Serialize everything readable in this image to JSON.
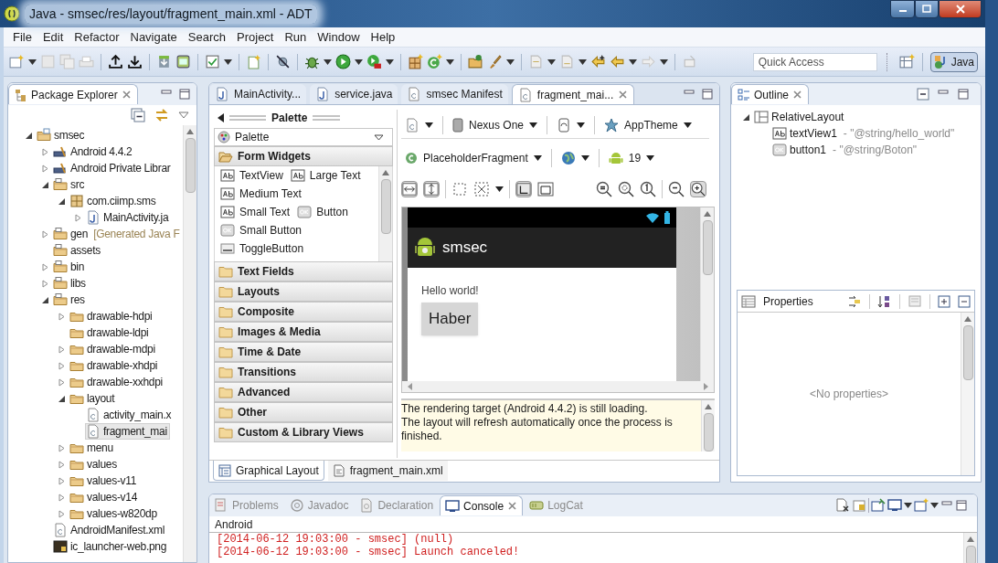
{
  "window": {
    "title": "Java - smsec/res/layout/fragment_main.xml - ADT"
  },
  "menu_items": [
    "File",
    "Edit",
    "Refactor",
    "Navigate",
    "Search",
    "Project",
    "Run",
    "Window",
    "Help"
  ],
  "toolbar": {
    "quick_access": {
      "placeholder": "Quick Access"
    },
    "perspectives": [
      {
        "label": "Java",
        "selected": true
      }
    ]
  },
  "package_explorer": {
    "title": "Package Explorer",
    "tree": [
      {
        "label": "smsec",
        "kind": "project",
        "expanded": true,
        "selected": false,
        "children": [
          {
            "label": "Android 4.4.2",
            "kind": "library",
            "expanded": false,
            "selected": false
          },
          {
            "label": "Android Private Librar",
            "kind": "library",
            "expanded": false,
            "selected": false
          },
          {
            "label": "src",
            "kind": "source",
            "expanded": true,
            "selected": false,
            "children": [
              {
                "label": "com.ciimp.sms",
                "kind": "package",
                "expanded": true,
                "selected": false,
                "children": [
                  {
                    "label": "MainActivity.ja",
                    "kind": "java",
                    "expanded": false,
                    "selected": false
                  }
                ]
              }
            ]
          },
          {
            "label": "gen",
            "decoration": "[Generated Java F",
            "kind": "source",
            "expanded": false,
            "selected": false
          },
          {
            "label": "assets",
            "kind": "source",
            "selected": false
          },
          {
            "label": "bin",
            "kind": "source",
            "expanded": false,
            "selected": false
          },
          {
            "label": "libs",
            "kind": "source",
            "expanded": false,
            "selected": false
          },
          {
            "label": "res",
            "kind": "source",
            "expanded": true,
            "selected": false,
            "children": [
              {
                "label": "drawable-hdpi",
                "kind": "folder",
                "expanded": false,
                "selected": false
              },
              {
                "label": "drawable-ldpi",
                "kind": "folder",
                "selected": false
              },
              {
                "label": "drawable-mdpi",
                "kind": "folder",
                "expanded": false,
                "selected": false
              },
              {
                "label": "drawable-xhdpi",
                "kind": "folder",
                "expanded": false,
                "selected": false
              },
              {
                "label": "drawable-xxhdpi",
                "kind": "folder",
                "expanded": false,
                "selected": false
              },
              {
                "label": "layout",
                "kind": "folder",
                "expanded": true,
                "selected": false,
                "children": [
                  {
                    "label": "activity_main.x",
                    "kind": "xml",
                    "selected": false
                  },
                  {
                    "label": "fragment_mai",
                    "kind": "xml",
                    "selected": true
                  }
                ]
              },
              {
                "label": "menu",
                "kind": "folder",
                "expanded": false,
                "selected": false
              },
              {
                "label": "values",
                "kind": "folder",
                "expanded": false,
                "selected": false
              },
              {
                "label": "values-v11",
                "kind": "folder",
                "expanded": false,
                "selected": false
              },
              {
                "label": "values-v14",
                "kind": "folder",
                "expanded": false,
                "selected": false
              },
              {
                "label": "values-w820dp",
                "kind": "folder",
                "expanded": false,
                "selected": false
              }
            ]
          },
          {
            "label": "AndroidManifest.xml",
            "kind": "xml",
            "selected": false
          },
          {
            "label": "ic_launcher-web.png",
            "kind": "png",
            "selected": false
          }
        ]
      }
    ]
  },
  "editor_tabs": [
    {
      "label": "MainActivity...",
      "kind": "java",
      "selected": false
    },
    {
      "label": "service.java",
      "kind": "java",
      "selected": false
    },
    {
      "label": "smsec Manifest",
      "kind": "xml",
      "selected": false
    },
    {
      "label": "fragment_mai...",
      "kind": "xml",
      "selected": true
    }
  ],
  "palette": {
    "title": "Palette",
    "dropdown": "Palette",
    "categories": [
      {
        "label": "Form Widgets",
        "expanded": true,
        "rows": [
          [
            {
              "label": "TextView",
              "kind": "text"
            },
            {
              "label": "Large Text",
              "kind": "text"
            }
          ],
          [
            {
              "label": "Medium Text",
              "kind": "text"
            }
          ],
          [
            {
              "label": "Small Text",
              "kind": "text"
            },
            {
              "label": "Button",
              "kind": "button"
            }
          ],
          [
            {
              "label": "Small Button",
              "kind": "button"
            }
          ],
          [
            {
              "label": "ToggleButton",
              "kind": "toggle"
            }
          ]
        ]
      },
      {
        "label": "Text Fields",
        "expanded": false
      },
      {
        "label": "Layouts",
        "expanded": false
      },
      {
        "label": "Composite",
        "expanded": false
      },
      {
        "label": "Images & Media",
        "expanded": false
      },
      {
        "label": "Time & Date",
        "expanded": false
      },
      {
        "label": "Transitions",
        "expanded": false
      },
      {
        "label": "Advanced",
        "expanded": false
      },
      {
        "label": "Other",
        "expanded": false
      },
      {
        "label": "Custom & Library Views",
        "expanded": false
      }
    ]
  },
  "config": {
    "device": "Nexus One",
    "theme": "AppTheme",
    "fragment": "PlaceholderFragment",
    "api_level": "19"
  },
  "preview": {
    "app_title": "smsec",
    "text_view": "Hello world!",
    "button": "Haber"
  },
  "message": {
    "lines": [
      "The rendering target (Android 4.4.2) is still loading.",
      "The layout will refresh automatically once the process is finished."
    ]
  },
  "editor_bottom_tabs": [
    {
      "label": "Graphical Layout",
      "selected": true
    },
    {
      "label": "fragment_main.xml",
      "selected": false
    }
  ],
  "outline": {
    "title": "Outline",
    "tree": [
      {
        "label": "RelativeLayout",
        "kind": "relative",
        "expanded": true,
        "selected": false,
        "children": [
          {
            "label": "textView1",
            "detail": "- \"@string/hello_world\"",
            "kind": "text",
            "selected": false
          },
          {
            "label": "button1",
            "detail": "- \"@string/Boton\"",
            "kind": "button",
            "selected": false
          }
        ]
      }
    ]
  },
  "properties": {
    "title": "Properties",
    "empty": "<No properties>"
  },
  "console": {
    "tabs": [
      {
        "label": "Problems",
        "kind": "problems",
        "selected": false
      },
      {
        "label": "Javadoc",
        "kind": "javadoc",
        "selected": false
      },
      {
        "label": "Declaration",
        "kind": "declaration",
        "selected": false
      },
      {
        "label": "Console",
        "kind": "console",
        "selected": true
      },
      {
        "label": "LogCat",
        "kind": "logcat",
        "selected": false
      }
    ],
    "header": "Android",
    "lines": [
      "[2014-06-12 19:03:00 - smsec] (null)",
      "[2014-06-12 19:03:00 - smsec] Launch canceled!"
    ]
  }
}
